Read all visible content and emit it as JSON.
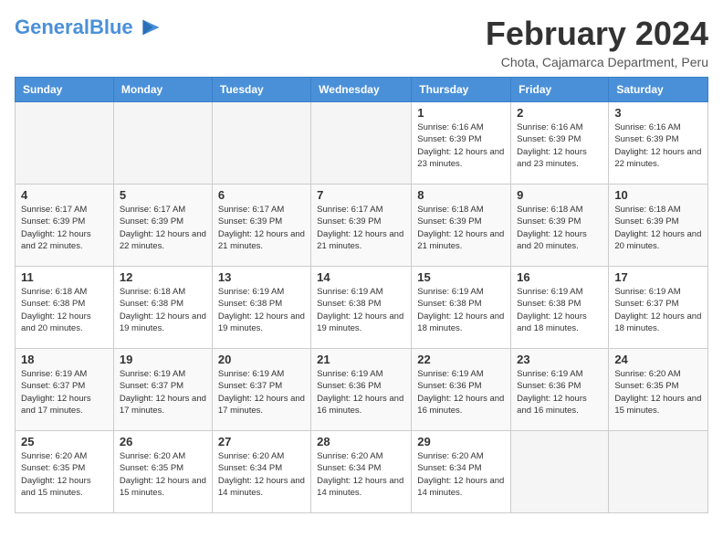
{
  "header": {
    "logo_text_general": "General",
    "logo_text_blue": "Blue",
    "month_title": "February 2024",
    "location": "Chota, Cajamarca Department, Peru"
  },
  "calendar": {
    "days_of_week": [
      "Sunday",
      "Monday",
      "Tuesday",
      "Wednesday",
      "Thursday",
      "Friday",
      "Saturday"
    ],
    "weeks": [
      [
        {
          "day": "",
          "info": ""
        },
        {
          "day": "",
          "info": ""
        },
        {
          "day": "",
          "info": ""
        },
        {
          "day": "",
          "info": ""
        },
        {
          "day": "1",
          "info": "Sunrise: 6:16 AM\nSunset: 6:39 PM\nDaylight: 12 hours and 23 minutes."
        },
        {
          "day": "2",
          "info": "Sunrise: 6:16 AM\nSunset: 6:39 PM\nDaylight: 12 hours and 23 minutes."
        },
        {
          "day": "3",
          "info": "Sunrise: 6:16 AM\nSunset: 6:39 PM\nDaylight: 12 hours and 22 minutes."
        }
      ],
      [
        {
          "day": "4",
          "info": "Sunrise: 6:17 AM\nSunset: 6:39 PM\nDaylight: 12 hours and 22 minutes."
        },
        {
          "day": "5",
          "info": "Sunrise: 6:17 AM\nSunset: 6:39 PM\nDaylight: 12 hours and 22 minutes."
        },
        {
          "day": "6",
          "info": "Sunrise: 6:17 AM\nSunset: 6:39 PM\nDaylight: 12 hours and 21 minutes."
        },
        {
          "day": "7",
          "info": "Sunrise: 6:17 AM\nSunset: 6:39 PM\nDaylight: 12 hours and 21 minutes."
        },
        {
          "day": "8",
          "info": "Sunrise: 6:18 AM\nSunset: 6:39 PM\nDaylight: 12 hours and 21 minutes."
        },
        {
          "day": "9",
          "info": "Sunrise: 6:18 AM\nSunset: 6:39 PM\nDaylight: 12 hours and 20 minutes."
        },
        {
          "day": "10",
          "info": "Sunrise: 6:18 AM\nSunset: 6:39 PM\nDaylight: 12 hours and 20 minutes."
        }
      ],
      [
        {
          "day": "11",
          "info": "Sunrise: 6:18 AM\nSunset: 6:38 PM\nDaylight: 12 hours and 20 minutes."
        },
        {
          "day": "12",
          "info": "Sunrise: 6:18 AM\nSunset: 6:38 PM\nDaylight: 12 hours and 19 minutes."
        },
        {
          "day": "13",
          "info": "Sunrise: 6:19 AM\nSunset: 6:38 PM\nDaylight: 12 hours and 19 minutes."
        },
        {
          "day": "14",
          "info": "Sunrise: 6:19 AM\nSunset: 6:38 PM\nDaylight: 12 hours and 19 minutes."
        },
        {
          "day": "15",
          "info": "Sunrise: 6:19 AM\nSunset: 6:38 PM\nDaylight: 12 hours and 18 minutes."
        },
        {
          "day": "16",
          "info": "Sunrise: 6:19 AM\nSunset: 6:38 PM\nDaylight: 12 hours and 18 minutes."
        },
        {
          "day": "17",
          "info": "Sunrise: 6:19 AM\nSunset: 6:37 PM\nDaylight: 12 hours and 18 minutes."
        }
      ],
      [
        {
          "day": "18",
          "info": "Sunrise: 6:19 AM\nSunset: 6:37 PM\nDaylight: 12 hours and 17 minutes."
        },
        {
          "day": "19",
          "info": "Sunrise: 6:19 AM\nSunset: 6:37 PM\nDaylight: 12 hours and 17 minutes."
        },
        {
          "day": "20",
          "info": "Sunrise: 6:19 AM\nSunset: 6:37 PM\nDaylight: 12 hours and 17 minutes."
        },
        {
          "day": "21",
          "info": "Sunrise: 6:19 AM\nSunset: 6:36 PM\nDaylight: 12 hours and 16 minutes."
        },
        {
          "day": "22",
          "info": "Sunrise: 6:19 AM\nSunset: 6:36 PM\nDaylight: 12 hours and 16 minutes."
        },
        {
          "day": "23",
          "info": "Sunrise: 6:19 AM\nSunset: 6:36 PM\nDaylight: 12 hours and 16 minutes."
        },
        {
          "day": "24",
          "info": "Sunrise: 6:20 AM\nSunset: 6:35 PM\nDaylight: 12 hours and 15 minutes."
        }
      ],
      [
        {
          "day": "25",
          "info": "Sunrise: 6:20 AM\nSunset: 6:35 PM\nDaylight: 12 hours and 15 minutes."
        },
        {
          "day": "26",
          "info": "Sunrise: 6:20 AM\nSunset: 6:35 PM\nDaylight: 12 hours and 15 minutes."
        },
        {
          "day": "27",
          "info": "Sunrise: 6:20 AM\nSunset: 6:34 PM\nDaylight: 12 hours and 14 minutes."
        },
        {
          "day": "28",
          "info": "Sunrise: 6:20 AM\nSunset: 6:34 PM\nDaylight: 12 hours and 14 minutes."
        },
        {
          "day": "29",
          "info": "Sunrise: 6:20 AM\nSunset: 6:34 PM\nDaylight: 12 hours and 14 minutes."
        },
        {
          "day": "",
          "info": ""
        },
        {
          "day": "",
          "info": ""
        }
      ]
    ]
  }
}
